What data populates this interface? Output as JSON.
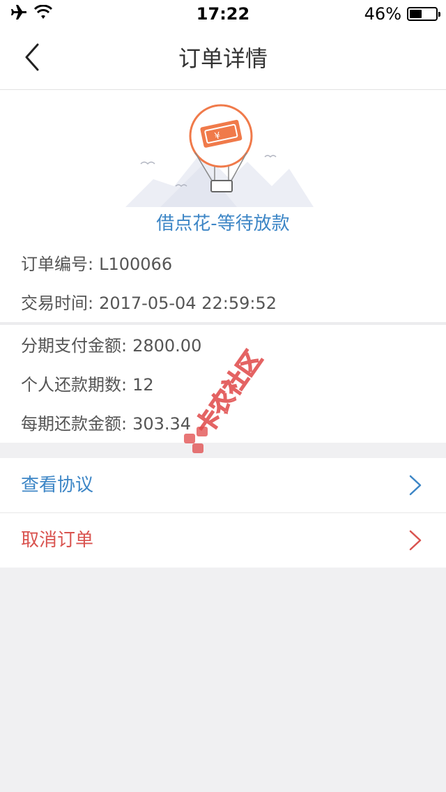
{
  "status_bar": {
    "time": "17:22",
    "battery_percent": "46%",
    "battery_level": 0.46
  },
  "nav": {
    "title": "订单详情",
    "back_icon": "chevron-left-icon"
  },
  "order": {
    "status_caption": "借点花-等待放款",
    "number_label": "订单编号:",
    "number_value": "L100066",
    "time_label": "交易时间:",
    "time_value": "2017-05-04 22:59:52"
  },
  "payment": {
    "total_label": "分期支付金额:",
    "total_value": "2800.00",
    "periods_label": "个人还款期数:",
    "periods_value": "12",
    "per_period_label": "每期还款金额:",
    "per_period_value": "303.34"
  },
  "actions": [
    {
      "label": "查看协议",
      "color": "#3d86c6"
    },
    {
      "label": "取消订单",
      "color": "#d9534f"
    }
  ],
  "watermark": {
    "text": "卡农社区",
    "color": "#e04848"
  },
  "colors": {
    "accent_blue": "#3d86c6",
    "accent_red": "#d9534f",
    "balloon_orange": "#f07a4a",
    "background": "#f0f0f2"
  }
}
